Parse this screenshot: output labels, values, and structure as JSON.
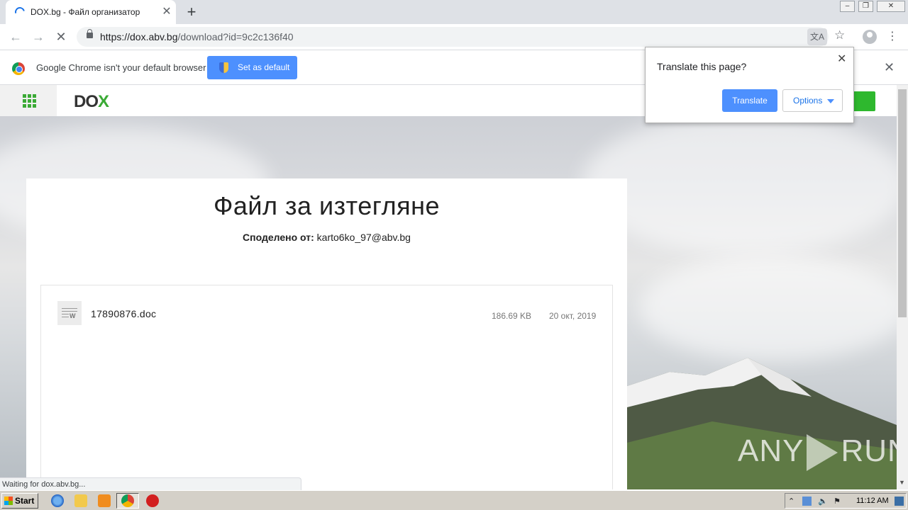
{
  "browser": {
    "tab_title": "DOX.bg - Файл организатор",
    "url_host": "https://dox.abv.bg",
    "url_path": "/download?id=9c2c136f40",
    "window_controls": [
      "minimize",
      "restore",
      "close"
    ]
  },
  "infobar": {
    "message": "Google Chrome isn't your default browser",
    "button_label": "Set as default"
  },
  "translate_bubble": {
    "title": "Translate this page?",
    "translate_label": "Translate",
    "options_label": "Options"
  },
  "site": {
    "logo_text": "DO",
    "logo_accent": "X",
    "brand_color": "#3aaa35"
  },
  "download": {
    "title": "Файл за изтегляне",
    "shared_label": "Споделено от:",
    "shared_by": "karto6ko_97@abv.bg",
    "files": [
      {
        "name": "17890876.doc",
        "size": "186.69 KB",
        "date": "20 окт, 2019",
        "icon": "word-doc-icon"
      }
    ]
  },
  "status_text": "Waiting for dox.abv.bg...",
  "watermark": {
    "left": "ANY",
    "right": "RUN"
  },
  "taskbar": {
    "start_label": "Start",
    "clock": "11:12 AM"
  }
}
